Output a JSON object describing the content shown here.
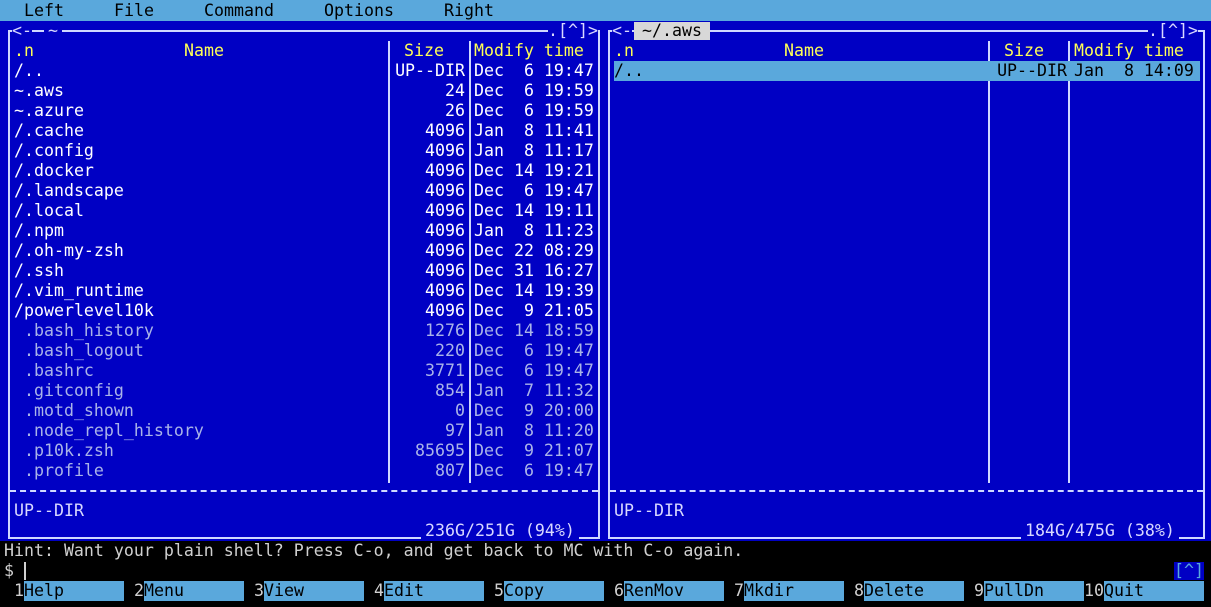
{
  "menu": [
    "Left",
    "File",
    "Command",
    "Options",
    "Right"
  ],
  "left_panel": {
    "path": "~",
    "history_btn": ".[^]>",
    "back_btn": "<-",
    "headers": {
      "name_sort": ".n",
      "name": "Name",
      "size": "Size",
      "modify": "Modify time"
    },
    "rows": [
      {
        "name": "/..",
        "size": "UP--DIR",
        "modified": "Dec  6 19:47",
        "type": "dir"
      },
      {
        "name": "~.aws",
        "size": "24",
        "modified": "Dec  6 19:59",
        "type": "dir"
      },
      {
        "name": "~.azure",
        "size": "26",
        "modified": "Dec  6 19:59",
        "type": "dir"
      },
      {
        "name": "/.cache",
        "size": "4096",
        "modified": "Jan  8 11:41",
        "type": "dir"
      },
      {
        "name": "/.config",
        "size": "4096",
        "modified": "Jan  8 11:17",
        "type": "dir"
      },
      {
        "name": "/.docker",
        "size": "4096",
        "modified": "Dec 14 19:21",
        "type": "dir"
      },
      {
        "name": "/.landscape",
        "size": "4096",
        "modified": "Dec  6 19:47",
        "type": "dir"
      },
      {
        "name": "/.local",
        "size": "4096",
        "modified": "Dec 14 19:11",
        "type": "dir"
      },
      {
        "name": "/.npm",
        "size": "4096",
        "modified": "Jan  8 11:23",
        "type": "dir"
      },
      {
        "name": "/.oh-my-zsh",
        "size": "4096",
        "modified": "Dec 22 08:29",
        "type": "dir"
      },
      {
        "name": "/.ssh",
        "size": "4096",
        "modified": "Dec 31 16:27",
        "type": "dir"
      },
      {
        "name": "/.vim_runtime",
        "size": "4096",
        "modified": "Dec 14 19:39",
        "type": "dir"
      },
      {
        "name": "/powerlevel10k",
        "size": "4096",
        "modified": "Dec  9 21:05",
        "type": "dir"
      },
      {
        "name": " .bash_history",
        "size": "1276",
        "modified": "Dec 14 18:59",
        "type": "file"
      },
      {
        "name": " .bash_logout",
        "size": "220",
        "modified": "Dec  6 19:47",
        "type": "file"
      },
      {
        "name": " .bashrc",
        "size": "3771",
        "modified": "Dec  6 19:47",
        "type": "file"
      },
      {
        "name": " .gitconfig",
        "size": "854",
        "modified": "Jan  7 11:32",
        "type": "file"
      },
      {
        "name": " .motd_shown",
        "size": "0",
        "modified": "Dec  9 20:00",
        "type": "file"
      },
      {
        "name": " .node_repl_history",
        "size": "97",
        "modified": "Jan  8 11:20",
        "type": "file"
      },
      {
        "name": " .p10k.zsh",
        "size": "85695",
        "modified": "Dec  9 21:07",
        "type": "file"
      },
      {
        "name": " .profile",
        "size": "807",
        "modified": "Dec  6 19:47",
        "type": "file"
      }
    ],
    "status": "UP--DIR",
    "disk_usage": "236G/251G (94%)"
  },
  "right_panel": {
    "path": "~/.aws",
    "history_btn": ".[^]>",
    "back_btn": "<-",
    "headers": {
      "name_sort": ".n",
      "name": "Name",
      "size": "Size",
      "modify": "Modify time"
    },
    "rows": [
      {
        "name": "/..",
        "size": "UP--DIR",
        "modified": "Jan  8 14:09",
        "type": "dir",
        "selected": true
      }
    ],
    "status": "UP--DIR",
    "disk_usage": "184G/475G (38%)"
  },
  "hint": "Hint: Want your plain shell? Press C-o, and get back to MC with C-o again.",
  "prompt": "$",
  "corner_btn": "[^]",
  "fkeys": [
    {
      "num": "1",
      "label": "Help"
    },
    {
      "num": "2",
      "label": "Menu"
    },
    {
      "num": "3",
      "label": "View"
    },
    {
      "num": "4",
      "label": "Edit"
    },
    {
      "num": "5",
      "label": "Copy"
    },
    {
      "num": "6",
      "label": "RenMov"
    },
    {
      "num": "7",
      "label": "Mkdir"
    },
    {
      "num": "8",
      "label": "Delete"
    },
    {
      "num": "9",
      "label": "PullDn"
    },
    {
      "num": "10",
      "label": "Quit"
    }
  ],
  "colors": {
    "panel_bg": "#0000c4",
    "menubar_bg": "#5aa8dc",
    "header_fg": "#ffff55",
    "file_fg": "#aab4e8"
  }
}
